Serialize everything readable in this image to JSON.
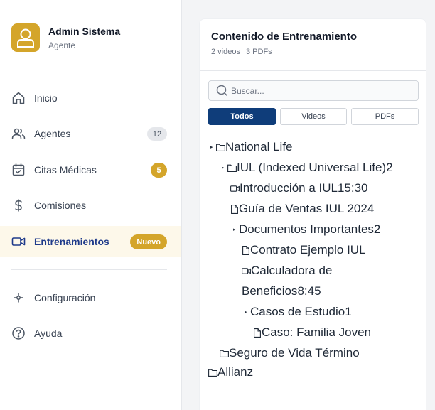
{
  "profile": {
    "name": "Admin Sistema",
    "role": "Agente"
  },
  "nav": {
    "inicio": "Inicio",
    "agentes": "Agentes",
    "agentes_count": "12",
    "citas": "Citas Médicas",
    "citas_count": "5",
    "comisiones": "Comisiones",
    "entrenamientos": "Entrenamientos",
    "entrenamientos_badge": "Nuevo",
    "configuracion": "Configuración",
    "ayuda": "Ayuda"
  },
  "card": {
    "title": "Contenido de Entrenamiento",
    "videos": "2 videos",
    "pdfs": "3 PDFs",
    "search_placeholder": "Buscar...",
    "tabs": {
      "all": "Todos",
      "videos": "Videos",
      "pdfs": "PDFs"
    }
  },
  "tree": {
    "national": "National Life",
    "iul": "IUL (Indexed Universal Life)",
    "iul_count": "2",
    "intro": "Introducción a IUL",
    "intro_time": "15:30",
    "guia": "Guía de Ventas IUL 2024",
    "docs": "Documentos Importantes",
    "docs_count": "2",
    "contrato": "Contrato Ejemplo IUL",
    "calc_line1": "Calculadora de",
    "calc_line2": "Beneficios",
    "calc_time": "8:45",
    "casos": "Casos de Estudio",
    "casos_count": "1",
    "caso": "Caso: Familia Joven",
    "seguro": "Seguro de Vida Término",
    "allianz": "Allianz"
  },
  "colors": {
    "accent_gold": "#d4a52a",
    "primary_navy": "#0f3d7a",
    "active_bg": "#fdf8ea"
  }
}
